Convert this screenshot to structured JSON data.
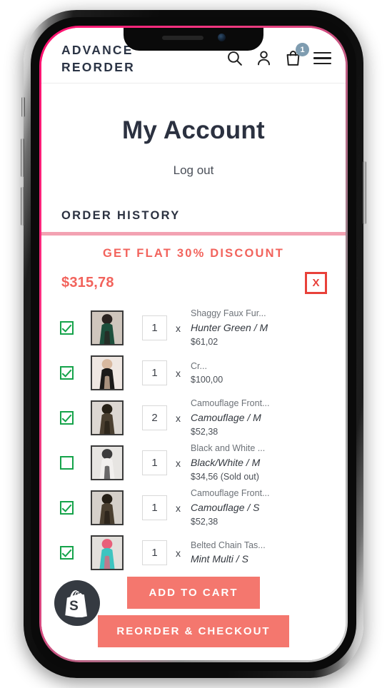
{
  "header": {
    "brand": "ADVANCE\nREORDER",
    "icons": {
      "search": "search-icon",
      "account": "account-icon",
      "cart": "shopping-bag-icon",
      "menu": "hamburger-menu-icon"
    },
    "cart_count": "1"
  },
  "account": {
    "title": "My Account",
    "logout_label": "Log out"
  },
  "order_history": {
    "heading": "ORDER HISTORY",
    "discount_banner": "GET FLAT 30% DISCOUNT",
    "total": "$315,78",
    "close_label": "X",
    "multiply_symbol": "x"
  },
  "products": [
    {
      "checked": true,
      "qty": "1",
      "title": "Shaggy Faux Fur...",
      "variant": "Hunter Green / M",
      "price": "$61,02",
      "thumb_colors": [
        "#cfc6bd",
        "#1d4f3c",
        "#2a2320"
      ]
    },
    {
      "checked": true,
      "qty": "1",
      "title": "Cr...",
      "variant": "",
      "price": "$100,00",
      "thumb_colors": [
        "#efe7e2",
        "#1b1a19",
        "#d8b9a0"
      ]
    },
    {
      "checked": true,
      "qty": "2",
      "title": "Camouflage Front...",
      "variant": "Camouflage / M",
      "price": "$52,38",
      "thumb_colors": [
        "#dcd7d2",
        "#4a3f30",
        "#262016"
      ]
    },
    {
      "checked": false,
      "qty": "1",
      "title": "Black and White ...",
      "variant": "Black/White / M",
      "price": "$34,56 (Sold out)",
      "thumb_colors": [
        "#e7e5e2",
        "#f2f0ee",
        "#3c3c3c"
      ]
    },
    {
      "checked": true,
      "qty": "1",
      "title": "Camouflage Front...",
      "variant": "Camouflage / S",
      "price": "$52,38",
      "thumb_colors": [
        "#d5d0ca",
        "#4a3f30",
        "#241e15"
      ]
    },
    {
      "checked": true,
      "qty": "1",
      "title": "Belted Chain Tas...",
      "variant": "Mint Multi / S",
      "price": "",
      "thumb_colors": [
        "#e3e0dc",
        "#3ec4c0",
        "#e8607a"
      ]
    }
  ],
  "footer": {
    "add_to_cart_label": "ADD TO CART",
    "reorder_checkout_label": "REORDER & CHECKOUT",
    "badge": "shopify-logo-icon"
  },
  "colors": {
    "accent_coral": "#f4776e",
    "accent_red": "#f2635c",
    "divider_pink": "#f3a2b2",
    "checkbox_green": "#15a34a",
    "brand_navy": "#2b3445",
    "badge_blue": "#7e9cb0"
  }
}
